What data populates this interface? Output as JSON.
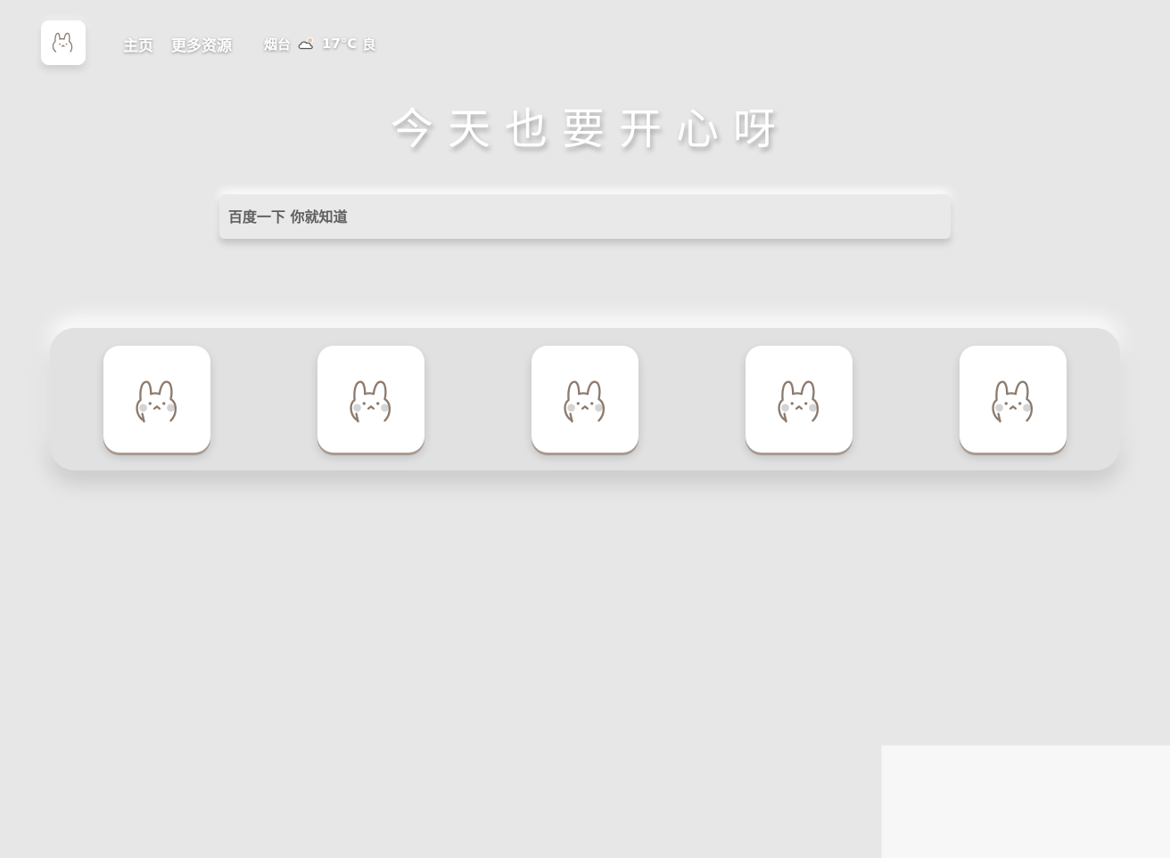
{
  "header": {
    "logo": {
      "icon": "bunny-logo-icon"
    },
    "nav": [
      {
        "label": "主页"
      },
      {
        "label": "更多资源"
      }
    ],
    "weather": {
      "city": "烟台",
      "icon": "cloud-icon",
      "temperature": "17°C",
      "air_quality": "良"
    }
  },
  "slogan": "今天也要开心呀",
  "search": {
    "placeholder": "百度一下 你就知道",
    "value": ""
  },
  "bookmarks": [
    {
      "icon": "bunny-icon"
    },
    {
      "icon": "bunny-icon"
    },
    {
      "icon": "bunny-icon"
    },
    {
      "icon": "bunny-icon"
    },
    {
      "icon": "bunny-icon"
    }
  ],
  "colors": {
    "background": "#e7e7e7",
    "panel": "#e1e1e1",
    "tile": "#ffffff",
    "tile_edge": "#a99a90",
    "bunny_line": "#8c7a6d",
    "bunny_cheek": "#d4d4d4",
    "text_light": "#ffffff",
    "search_text": "#5f5f5f"
  }
}
